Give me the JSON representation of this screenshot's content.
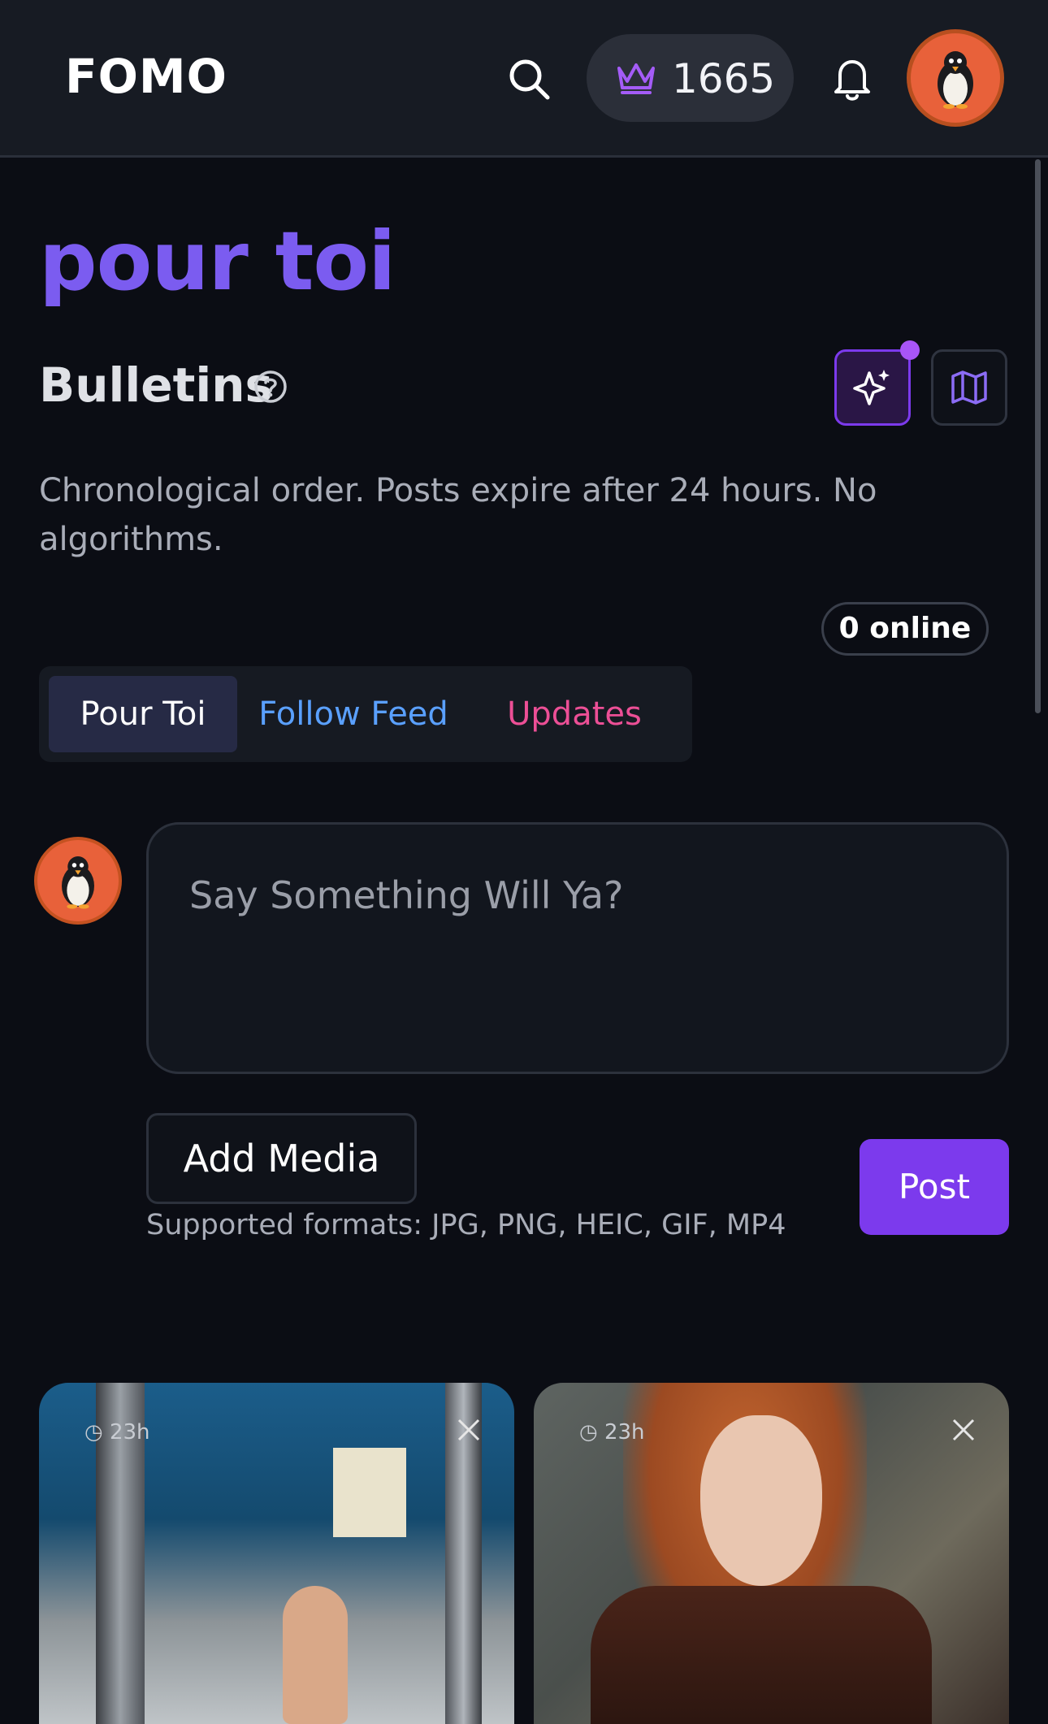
{
  "header": {
    "brand": "FOMO",
    "points": "1665",
    "icons": {
      "search": "search-icon",
      "crown": "crown-icon",
      "bell": "bell-icon",
      "avatar": "penguin-avatar"
    }
  },
  "page": {
    "title": "pour toi",
    "section_title": "Bulletins",
    "description": "Chronological order. Posts expire after 24 hours. No algorithms.",
    "online": "0 online"
  },
  "tabs": [
    {
      "label": "Pour Toi",
      "active": true
    },
    {
      "label": "Follow Feed",
      "active": false
    },
    {
      "label": "Updates",
      "active": false
    }
  ],
  "composer": {
    "placeholder": "Say Something Will Ya?",
    "add_media_label": "Add Media",
    "formats_note": "Supported formats: JPG, PNG, HEIC, GIF, MP4",
    "post_label": "Post"
  },
  "feed": [
    {
      "age": "23h"
    },
    {
      "age": "23h"
    }
  ],
  "colors": {
    "accent": "#7c3aed",
    "title": "#7b5cf0",
    "follow_tab": "#5aa0ff",
    "updates_tab": "#ec4f96",
    "avatar_bg": "#e8613a"
  }
}
